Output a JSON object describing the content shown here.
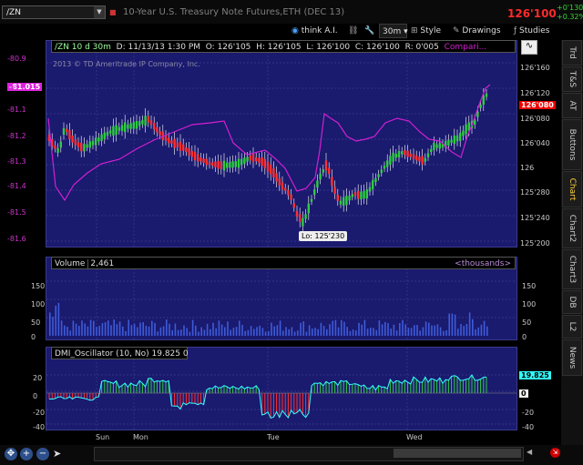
{
  "symbol": "/ZN",
  "window_title": "10-Year U.S. Treasury Note Futures,ETH (DEC 13)",
  "last_price": "126'100",
  "change_abs": "+0'130",
  "change_pct": "+0.32%",
  "toolbar": {
    "think": "think A.I.",
    "timeframe": "30m",
    "style": "Style",
    "drawings": "Drawings",
    "studies": "Studies"
  },
  "info": {
    "sym": "/ZN 10 d 30m",
    "date": "D: 11/13/13 1:30 PM",
    "open": "O: 126'105",
    "high": "H: 126'105",
    "low": "L: 126'100",
    "close": "C: 126'100",
    "range": "R: 0'005",
    "compare": "Compari..."
  },
  "copyright": "2013 © TD Ameritrade IP Company, Inc.",
  "low_label": "Lo: 125'230",
  "left_marker": "-81.015",
  "price_marker": "126'080",
  "left_axis": [
    "-80.9",
    "-81",
    "-81.1",
    "-81.2",
    "-81.3",
    "-81.4",
    "-81.5",
    "-81.6"
  ],
  "right_axis": [
    "126'160",
    "126'120",
    "126'080",
    "126'040",
    "126",
    "125'280",
    "125'240",
    "125'200"
  ],
  "volume": {
    "label": "Volume",
    "value": "2,461",
    "units": "<thousands>",
    "axis": [
      "150",
      "100",
      "50",
      "0"
    ]
  },
  "dmi": {
    "label": "DMI_Oscillator (10, No)",
    "value": "19.825",
    "zero": "0",
    "current_tag": "19.825",
    "zero_tag": "0",
    "axis": [
      "20",
      "0",
      "-20",
      "-40"
    ],
    "right_axis": [
      "20",
      "0",
      "-20",
      "-40"
    ]
  },
  "x_axis": [
    "Sun",
    "Mon",
    "Tue",
    "Wed"
  ],
  "right_tabs": [
    "Trd",
    "T&S",
    "AT",
    "Buttons",
    "Chart",
    "Chart2",
    "Chart3",
    "DB",
    "L2",
    "News"
  ],
  "active_tab": "Chart",
  "colors": {
    "panel_bg": "#1a1a6e",
    "up": "#2ecc40",
    "down": "#ff3030",
    "compare": "#d020d0",
    "volume": "#3d5bd8",
    "dmi_line": "#33ffff"
  }
}
